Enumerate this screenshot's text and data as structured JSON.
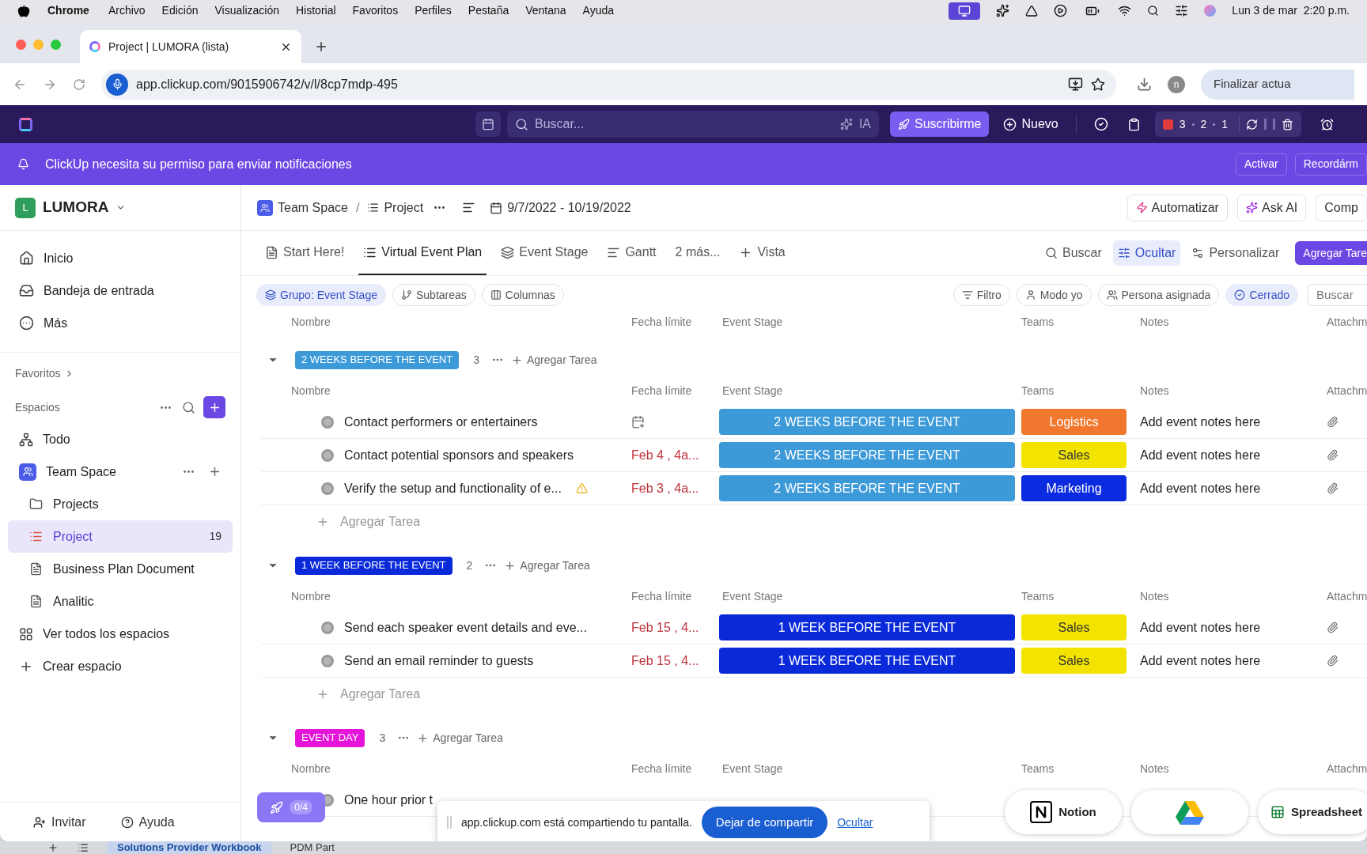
{
  "menubar": {
    "app": "Chrome",
    "menus": [
      "Archivo",
      "Edición",
      "Visualización",
      "Historial",
      "Favoritos",
      "Perfiles",
      "Pestaña",
      "Ventana",
      "Ayuda"
    ],
    "clock": "Lun 3 de mar  2:20 p.m."
  },
  "browser": {
    "tab_title": "Project | LUMORA (lista)",
    "url": "app.clickup.com/9015906742/v/l/8cp7mdp-495",
    "profile_initial": "n",
    "update_button": "Finalizar actua"
  },
  "topbar": {
    "search_placeholder": "Buscar...",
    "ai_label": "IA",
    "subscribe": "Suscribirme",
    "new": "Nuevo",
    "timer": [
      "3",
      "2",
      "1"
    ]
  },
  "banner": {
    "text": "ClickUp necesita su permiso para enviar notificaciones",
    "buttons": [
      "Activar",
      "Recordárm"
    ]
  },
  "sidebar": {
    "workspace_initial": "L",
    "workspace": "LUMORA",
    "nav": [
      {
        "label": "Inicio"
      },
      {
        "label": "Bandeja de entrada"
      },
      {
        "label": "Más"
      }
    ],
    "favorites": "Favoritos",
    "spaces": "Espacios",
    "items": [
      {
        "label": "Todo",
        "selected": false
      },
      {
        "label": "Team Space",
        "selected": false,
        "children": [
          {
            "label": "Projects",
            "selected": false
          },
          {
            "label": "Project",
            "selected": true,
            "count": "19"
          },
          {
            "label": "Business Plan Document",
            "selected": false
          },
          {
            "label": "Analitic",
            "selected": false
          }
        ]
      },
      {
        "label": "Ver todos los espacios",
        "selected": false
      },
      {
        "label": "Crear espacio",
        "selected": false
      }
    ],
    "footer": [
      "Invitar",
      "Ayuda"
    ]
  },
  "header": {
    "breadcrumb": [
      "Team Space",
      "Project"
    ],
    "separator": "/",
    "dates": "9/7/2022 - 10/19/2022",
    "buttons": [
      "Automatizar",
      "Ask AI",
      "Comp"
    ]
  },
  "views": [
    {
      "label": "Start Here!",
      "selected": false
    },
    {
      "label": "Virtual Event Plan",
      "selected": true
    },
    {
      "label": "Event Stage",
      "selected": false
    },
    {
      "label": "Gantt",
      "selected": false
    },
    {
      "label": "2 más...",
      "selected": false
    },
    {
      "label": "Vista",
      "selected": false
    }
  ],
  "view_actions": [
    {
      "label": "Buscar",
      "selected": false
    },
    {
      "label": "Ocultar",
      "selected": true
    },
    {
      "label": "Personalizar",
      "selected": false
    }
  ],
  "add_task_button": "Agregar Tare",
  "filters_left": [
    {
      "label": "Grupo: Event Stage",
      "selected": true
    },
    {
      "label": "Subtareas",
      "selected": false
    },
    {
      "label": "Columnas",
      "selected": false
    }
  ],
  "filters_right": [
    {
      "label": "Filtro",
      "selected": false
    },
    {
      "label": "Modo yo",
      "selected": false
    },
    {
      "label": "Persona asignada",
      "selected": false
    },
    {
      "label": "Cerrado",
      "selected": true
    }
  ],
  "filter_search": "Buscar",
  "columns": [
    "Nombre",
    "Fecha límite",
    "Event Stage",
    "Teams",
    "Notes",
    "Attachm"
  ],
  "groups": [
    {
      "label": "2 WEEKS BEFORE THE EVENT",
      "color": "#3d9ad9",
      "count": "3",
      "add_label": "Agregar Tarea",
      "add_row": "Agregar Tarea",
      "expanded": true,
      "columns": [
        "Nombre",
        "Fecha límite",
        "Event Stage",
        "Teams",
        "Notes",
        "Attachm"
      ],
      "rows": [
        {
          "name": "Contact performers or entertainers",
          "stage": "2 WEEKS BEFORE THE EVENT",
          "team": {
            "label": "Logistics",
            "color": "#f0772d"
          },
          "notes": "Add event notes here",
          "warning": false
        },
        {
          "name": "Contact potential sponsors and speakers",
          "date": "Feb 4 , 4a...",
          "stage": "2 WEEKS BEFORE THE EVENT",
          "team": {
            "label": "Sales",
            "color": "#f2e300"
          },
          "notes": "Add event notes here",
          "warning": false
        },
        {
          "name": "Verify the setup and functionality of e...",
          "date": "Feb 3 , 4a...",
          "stage": "2 WEEKS BEFORE THE EVENT",
          "team": {
            "label": "Marketing",
            "color": "#0b2be0"
          },
          "notes": "Add event notes here",
          "warning": true
        }
      ]
    },
    {
      "label": "1 WEEK BEFORE THE EVENT",
      "color": "#0a2ad9",
      "count": "2",
      "add_label": "Agregar Tarea",
      "add_row": "Agregar Tarea",
      "expanded": true,
      "columns": [
        "Nombre",
        "Fecha límite",
        "Event Stage",
        "Teams",
        "Notes",
        "Attachm"
      ],
      "rows": [
        {
          "name": "Send each speaker event details and eve...",
          "date": "Feb 15 , 4...",
          "stage": "1 WEEK BEFORE THE EVENT",
          "team": {
            "label": "Sales",
            "color": "#f2e300"
          },
          "notes": "Add event notes here",
          "warning": false
        },
        {
          "name": "Send an email reminder to guests",
          "date": "Feb 15 , 4...",
          "stage": "1 WEEK BEFORE THE EVENT",
          "team": {
            "label": "Sales",
            "color": "#f2e300"
          },
          "notes": "Add event notes here",
          "warning": false
        }
      ]
    },
    {
      "label": "EVENT DAY",
      "color": "#e414d8",
      "count": "3",
      "add_label": "Agregar Tarea",
      "expanded": true,
      "columns": [
        "Nombre",
        "Fecha límite",
        "Event Stage",
        "Teams",
        "Notes",
        "Attachm"
      ],
      "rows": [
        {
          "name": "One hour prior t",
          "warning": false
        }
      ]
    }
  ],
  "launcher": "0/4",
  "share_bar": {
    "text": "app.clickup.com está compartiendo tu pantalla.",
    "stop": "Dejar de compartir",
    "hide": "Ocultar"
  },
  "integrations": [
    {
      "label": "Notion",
      "kind": "notion"
    },
    {
      "kind": "drive"
    },
    {
      "label": "Spreadsheet",
      "kind": "sheet"
    }
  ],
  "dock": [
    "Solutions Provider Workbook",
    "PDM Part"
  ]
}
